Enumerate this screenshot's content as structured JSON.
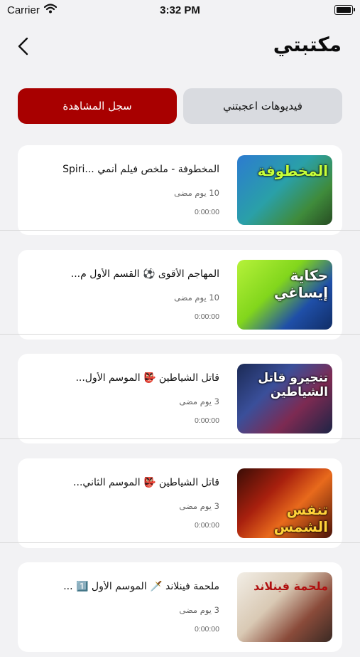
{
  "status_bar": {
    "carrier": "Carrier",
    "time": "3:32 PM"
  },
  "header": {
    "title": "مكتبتي"
  },
  "tabs": [
    {
      "label": "سجل المشاهدة",
      "active": true
    },
    {
      "label": "فيديوهات اعجبتني",
      "active": false
    }
  ],
  "videos": [
    {
      "title": "المخطوفة - ملخص فيلم أنمي ...Spiri",
      "date": "10 يوم مضى",
      "duration": "0:00:00",
      "thumb_text": "المخطوفة"
    },
    {
      "title": "المهاجم الأقوى ⚽ القسم الأول م...",
      "date": "10 يوم مضى",
      "duration": "0:00:00",
      "thumb_text": "حكاية إيساغي"
    },
    {
      "title": "قاتل الشياطين 👺 الموسم الأول...",
      "date": "3 يوم مضى",
      "duration": "0:00:00",
      "thumb_text": "تنجيرو قاتل الشياطين"
    },
    {
      "title": "قاتل الشياطين 👺 الموسم الثاني...",
      "date": "3 يوم مضى",
      "duration": "0:00:00",
      "thumb_text": "تنفس الشمس"
    },
    {
      "title": "ملحمة فينلاند 🗡️ الموسم الأول 1️⃣ ...",
      "date": "3 يوم مضى",
      "duration": "0:00:00",
      "thumb_text": "ملحمة فينلاند"
    }
  ],
  "colors": {
    "accent": "#a80000",
    "inactive_tab": "#d9dbe0",
    "background": "#f2f2f4"
  },
  "icons": {
    "back": "chevron-left-icon",
    "wifi": "wifi-icon",
    "battery": "battery-icon"
  }
}
